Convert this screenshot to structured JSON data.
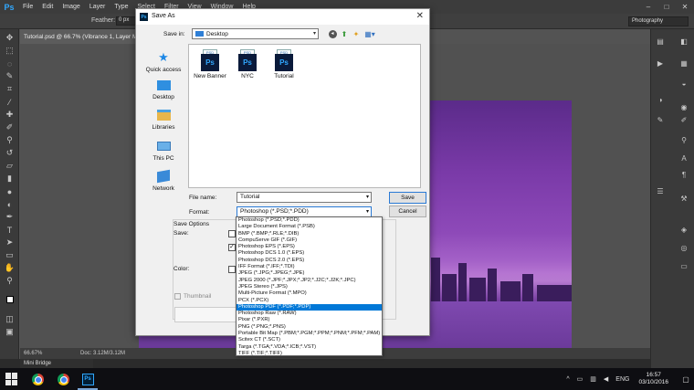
{
  "photoshop": {
    "logo": "Ps",
    "menu": [
      "File",
      "Edit",
      "Image",
      "Layer",
      "Type",
      "Select",
      "Filter",
      "View",
      "Window",
      "Help"
    ],
    "window_controls": [
      "–",
      "□",
      "✕"
    ],
    "options_bar": {
      "feather_label": "Feather:",
      "feather_value": "0 px",
      "workspace": "Photography"
    },
    "doc_tab": "Tutorial.psd @ 66.7% (Vibrance 1, Layer M",
    "status": {
      "zoom": "66.67%",
      "doc_size": "Doc: 3.12M/3.12M"
    },
    "mini_bridge": "Mini Bridge"
  },
  "dialog": {
    "title": "Save As",
    "save_in_label": "Save in:",
    "save_in_value": "Desktop",
    "places": [
      "Quick access",
      "Desktop",
      "Libraries",
      "This PC",
      "Network"
    ],
    "files": [
      {
        "badge": "PSD",
        "name": "New Banner"
      },
      {
        "badge": "PSD",
        "name": "NYC"
      },
      {
        "badge": "PSD",
        "name": "Tutorial"
      }
    ],
    "file_name_label": "File name:",
    "file_name_value": "Tutorial",
    "format_label": "Format:",
    "format_value": "Photoshop (*.PSD;*.PDD)",
    "save_button": "Save",
    "cancel_button": "Cancel",
    "save_options_title": "Save Options",
    "save_label": "Save:",
    "color_label": "Color:",
    "thumbnail_label": "Thumbnail"
  },
  "format_options": [
    "Photoshop (*.PSD;*.PDD)",
    "Large Document Format (*.PSB)",
    "BMP (*.BMP;*.RLE;*.DIB)",
    "CompuServe GIF (*.GIF)",
    "Photoshop EPS (*.EPS)",
    "Photoshop DCS 1.0 (*.EPS)",
    "Photoshop DCS 2.0 (*.EPS)",
    "IFF Format (*.IFF;*.TDI)",
    "JPEG (*.JPG;*.JPEG;*.JPE)",
    "JPEG 2000 (*.JPF;*.JPX;*.JP2;*.J2C;*.J2K;*.JPC)",
    "JPEG Stereo (*.JPS)",
    "Multi-Picture Format (*.MPO)",
    "PCX (*.PCX)",
    "Photoshop PDF (*.PDF;*.PDP)",
    "Photoshop Raw (*.RAW)",
    "Pixar (*.PXR)",
    "PNG (*.PNG;*.PNS)",
    "Portable Bit Map (*.PBM;*.PGM;*.PPM;*.PNM;*.PFM;*.PAM)",
    "Scitex CT (*.SCT)",
    "Targa (*.TGA;*.VDA;*.ICB;*.VST)",
    "TIFF (*.TIF;*.TIFF)"
  ],
  "highlighted_format_index": 13,
  "taskbar": {
    "language": "ENG",
    "time": "16:57",
    "date": "03/10/2016"
  },
  "colors": {
    "accent": "#0078d7",
    "ps_blue": "#31a8ff"
  }
}
